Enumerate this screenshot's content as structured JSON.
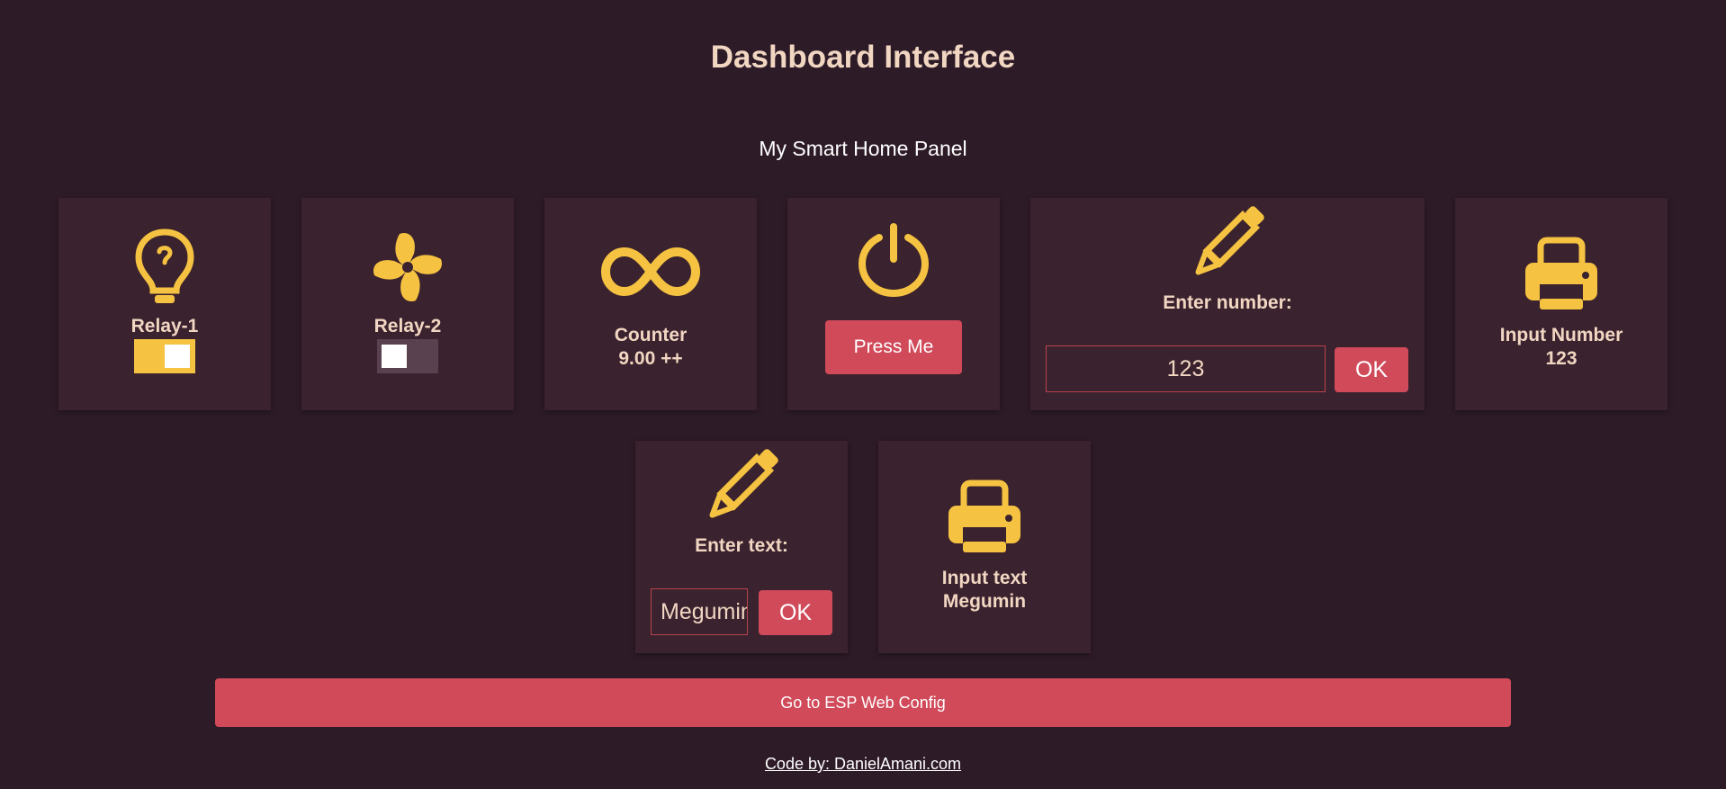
{
  "header": {
    "title": "Dashboard Interface",
    "subtitle": "My Smart Home Panel"
  },
  "colors": {
    "background": "#2e1b28",
    "card": "#3a222e",
    "accent_icon": "#f5c242",
    "button": "#d04a5a",
    "text": "#f1d6c2"
  },
  "cards": {
    "relay1": {
      "icon": "lightbulb-icon",
      "label": "Relay-1",
      "state": "on"
    },
    "relay2": {
      "icon": "fan-icon",
      "label": "Relay-2",
      "state": "off"
    },
    "counter": {
      "icon": "infinity-icon",
      "label": "Counter",
      "value": "9.00 ++"
    },
    "press": {
      "icon": "power-icon",
      "button_label": "Press Me"
    },
    "number_input": {
      "icon": "pencil-icon",
      "label": "Enter number:",
      "value": "123",
      "ok_label": "OK"
    },
    "number_display": {
      "icon": "printer-icon",
      "label": "Input Number",
      "value": "123"
    },
    "text_input": {
      "icon": "pencil-icon",
      "label": "Enter text:",
      "value": "Megumin",
      "ok_label": "OK"
    },
    "text_display": {
      "icon": "printer-icon",
      "label": "Input text",
      "value": "Megumin"
    }
  },
  "footer": {
    "config_button": "Go to ESP Web Config",
    "credit_link": "Code by: DanielAmani.com"
  }
}
